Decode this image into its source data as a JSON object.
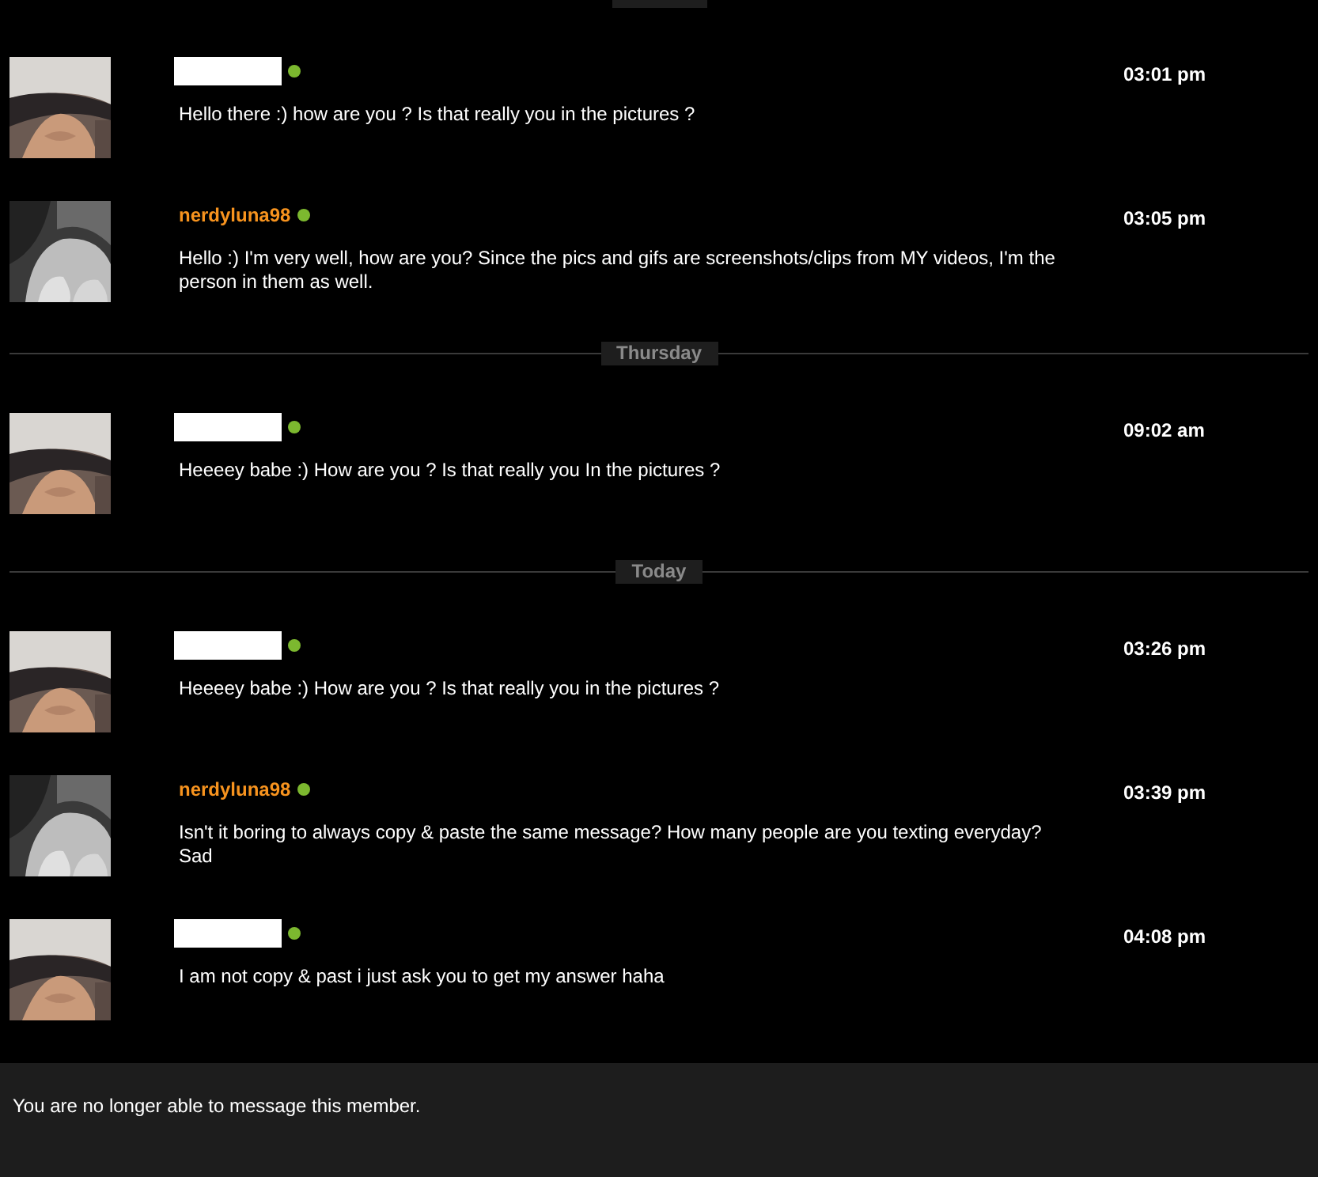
{
  "sections": [
    {
      "messages": [
        {
          "kind": "redacted",
          "online": true,
          "time": "03:01 pm",
          "text": "Hello there :) how are you ? Is that really you in the pictures ?"
        },
        {
          "kind": "named",
          "name": "nerdyluna98",
          "online": true,
          "time": "03:05 pm",
          "text": "Hello :) I'm very well, how are you? Since the pics and gifs are screenshots/clips from MY videos, I'm the person in them as well."
        }
      ]
    },
    {
      "date": "Thursday",
      "messages": [
        {
          "kind": "redacted",
          "online": true,
          "time": "09:02 am",
          "text": "Heeeey babe :) How are you ? Is that really you In the pictures ?"
        }
      ]
    },
    {
      "date": "Today",
      "messages": [
        {
          "kind": "redacted",
          "online": true,
          "time": "03:26 pm",
          "text": "Heeeey babe :) How are you ? Is that really you in the pictures ?"
        },
        {
          "kind": "named",
          "name": "nerdyluna98",
          "online": true,
          "time": "03:39 pm",
          "text": "Isn't it boring to always copy & paste the same message? How many people are you texting everyday? Sad"
        },
        {
          "kind": "redacted",
          "online": true,
          "time": "04:08 pm",
          "text": "I am not copy & past i just ask you to get my answer haha"
        }
      ]
    }
  ],
  "notice": "You are no longer able to message this member."
}
